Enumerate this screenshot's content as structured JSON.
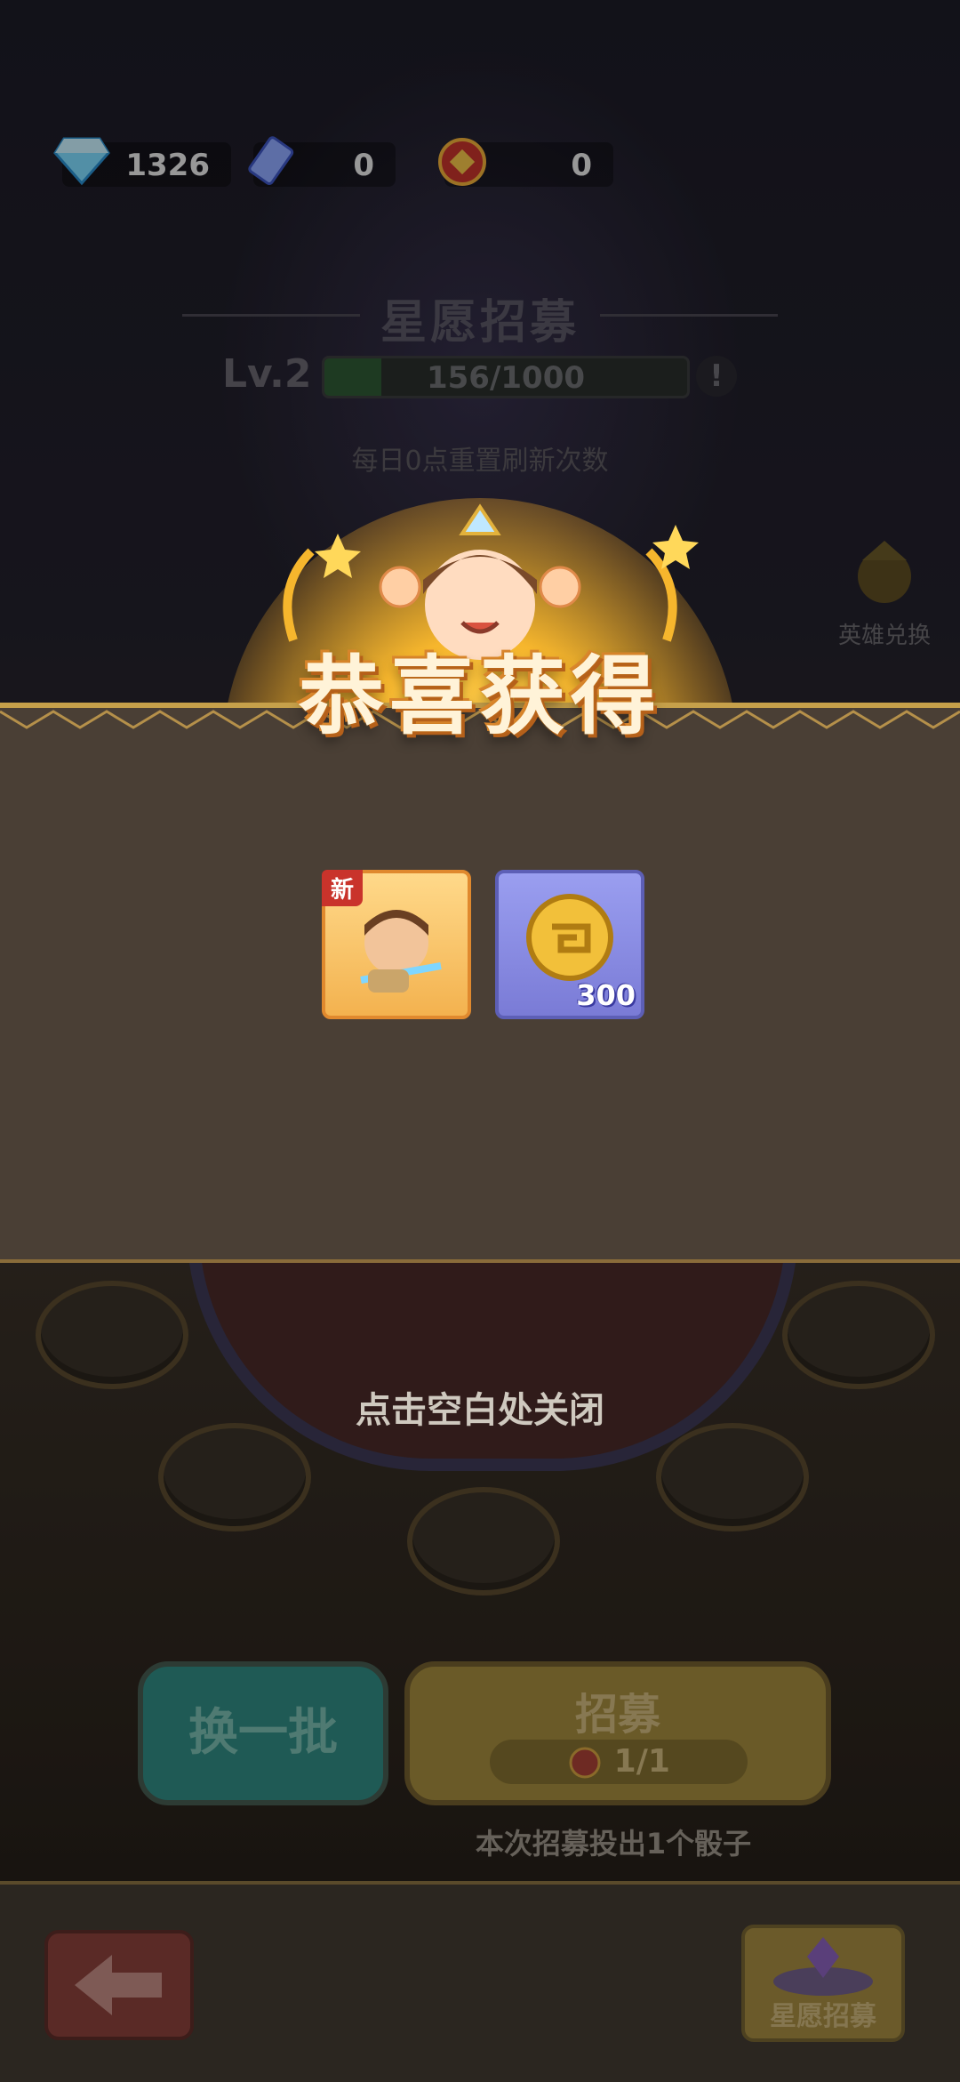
{
  "currencies": [
    {
      "icon": "diamond-icon",
      "value": "1326"
    },
    {
      "icon": "ticket-icon",
      "value": "0"
    },
    {
      "icon": "token-coin-icon",
      "value": "0"
    }
  ],
  "header": {
    "title": "星愿招募",
    "level_label": "Lv.2",
    "progress_text": "156/1000",
    "progress_fraction": 0.156,
    "info_symbol": "!",
    "reset_note": "每日0点重置刷新次数"
  },
  "side": {
    "hero_exchange_label": "英雄兑换"
  },
  "popup": {
    "title": "恭喜获得",
    "items": [
      {
        "type": "hero",
        "badge": "新"
      },
      {
        "type": "coin",
        "quantity": "300"
      }
    ],
    "close_hint": "点击空白处关闭"
  },
  "actions": {
    "swap_label": "换一批",
    "recruit_label": "招募",
    "recruit_cost": "1/1",
    "roll_note": "本次招募投出1个骰子"
  },
  "bottom_bar": {
    "recruit_tab_label": "星愿招募"
  },
  "colors": {
    "accent_gold": "#f6b62d",
    "progress_green": "#2f5a35",
    "swap_teal": "#1f5a55"
  }
}
